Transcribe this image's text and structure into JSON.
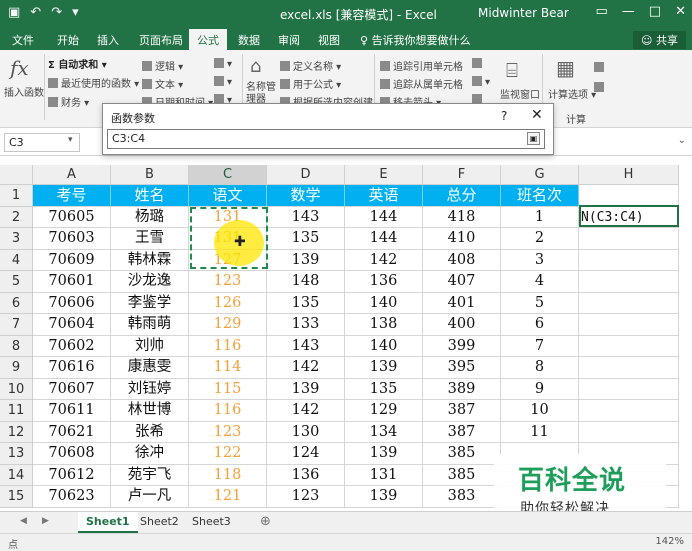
{
  "app": {
    "title": "excel.xls  [兼容模式] - Excel",
    "user": "Midwinter Bear",
    "share": "共享"
  },
  "ribbon": {
    "tabs": [
      "文件",
      "开始",
      "插入",
      "页面布局",
      "公式",
      "数据",
      "审阅",
      "视图"
    ],
    "active_tab": "公式",
    "tellme": "告诉我你想要做什么",
    "insert_function": "插入函数",
    "autosum": "自动求和",
    "recent": "最近使用的函数",
    "finance": "财务",
    "logic": "逻辑",
    "text": "文本",
    "datetime": "日期和时间",
    "name_mgr": "名称管理器",
    "define_name": "定义名称",
    "use_in_formula": "用于公式",
    "create_from_sel": "根据所选内容创建",
    "trace_precedents": "追踪引用单元格",
    "trace_dependents": "追踪从属单元格",
    "remove_arrows": "移去箭头",
    "watch": "监视窗口",
    "calc_options": "计算选项",
    "calc_group": "计算"
  },
  "formula_bar": {
    "name_box": "C3"
  },
  "dialog": {
    "title": "函数参数",
    "help": "?",
    "value": "C3:C4"
  },
  "grid": {
    "columns": [
      "A",
      "B",
      "C",
      "D",
      "E",
      "F",
      "G",
      "H"
    ],
    "rows": [
      "1",
      "2",
      "3",
      "4",
      "5",
      "6",
      "7",
      "8",
      "9",
      "10",
      "11",
      "12",
      "13",
      "14",
      "15"
    ],
    "header": [
      "考号",
      "姓名",
      "语文",
      "数学",
      "英语",
      "总分",
      "班名次",
      ""
    ],
    "data": [
      [
        "70605",
        "杨璐",
        "131",
        "143",
        "144",
        "418",
        "1",
        "N(C3:C4)"
      ],
      [
        "70603",
        "王雪",
        "131",
        "135",
        "144",
        "410",
        "2",
        ""
      ],
      [
        "70609",
        "韩林霖",
        "127",
        "139",
        "142",
        "408",
        "3",
        ""
      ],
      [
        "70601",
        "沙龙逸",
        "123",
        "148",
        "136",
        "407",
        "4",
        ""
      ],
      [
        "70606",
        "李鉴学",
        "126",
        "135",
        "140",
        "401",
        "5",
        ""
      ],
      [
        "70604",
        "韩雨萌",
        "129",
        "133",
        "138",
        "400",
        "6",
        ""
      ],
      [
        "70602",
        "刘帅",
        "116",
        "143",
        "140",
        "399",
        "7",
        ""
      ],
      [
        "70616",
        "康惠雯",
        "114",
        "142",
        "139",
        "395",
        "8",
        ""
      ],
      [
        "70607",
        "刘钰婷",
        "115",
        "139",
        "135",
        "389",
        "9",
        ""
      ],
      [
        "70611",
        "林世博",
        "116",
        "142",
        "129",
        "387",
        "10",
        ""
      ],
      [
        "70621",
        "张希",
        "123",
        "130",
        "134",
        "387",
        "11",
        ""
      ],
      [
        "70608",
        "徐冲",
        "122",
        "124",
        "139",
        "385",
        "",
        ""
      ],
      [
        "70612",
        "苑宇飞",
        "118",
        "136",
        "131",
        "385",
        "",
        ""
      ],
      [
        "70623",
        "卢一凡",
        "121",
        "123",
        "139",
        "383",
        "",
        ""
      ]
    ]
  },
  "sheets": [
    "Sheet1",
    "Sheet2",
    "Sheet3"
  ],
  "active_sheet": "Sheet1",
  "status": {
    "mode": "点",
    "zoom": "142%"
  },
  "watermark": {
    "big": "百科全说",
    "small": "助你轻松解决"
  },
  "colors": {
    "excel_green": "#217346",
    "header_fill": "#00b0f0",
    "chinese_score": "#f2a23a"
  }
}
